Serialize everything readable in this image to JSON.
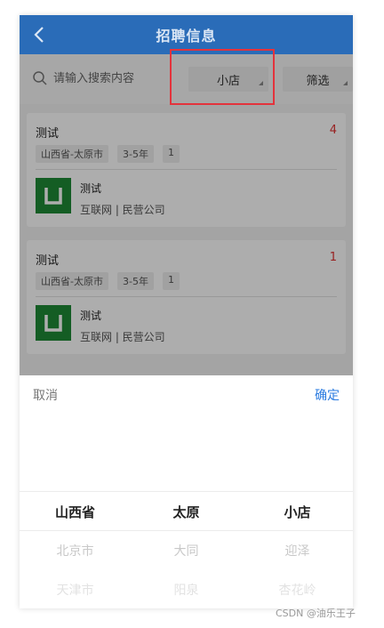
{
  "nav": {
    "title": "招聘信息"
  },
  "search": {
    "placeholder": "请输入搜索内容"
  },
  "filters": {
    "store": "小店",
    "filter": "筛选"
  },
  "jobs": [
    {
      "title": "测试",
      "count": "4",
      "tags": [
        "山西省-太原市",
        "3-5年",
        "1"
      ],
      "company": "测试",
      "info": "互联网 | 民营公司"
    },
    {
      "title": "测试",
      "count": "1",
      "tags": [
        "山西省-太原市",
        "3-5年",
        "1"
      ],
      "company": "测试",
      "info": "互联网 | 民营公司"
    }
  ],
  "picker": {
    "cancel": "取消",
    "confirm": "确定",
    "columns": [
      {
        "options": [
          "山西省",
          "北京市",
          "天津市"
        ]
      },
      {
        "options": [
          "太原",
          "大同",
          "阳泉"
        ]
      },
      {
        "options": [
          "小店",
          "迎泽",
          "杏花岭"
        ]
      }
    ]
  },
  "colors": {
    "navbar": "#2a6cb8",
    "accent": "#2a7be0",
    "count": "#e03131",
    "logo": "#1e8a36",
    "highlight": "#e4333c"
  },
  "icons": {
    "back": "chevron-left-icon",
    "search": "search-icon",
    "logo": "company-logo-icon"
  },
  "watermark": "CSDN @油乐王子"
}
